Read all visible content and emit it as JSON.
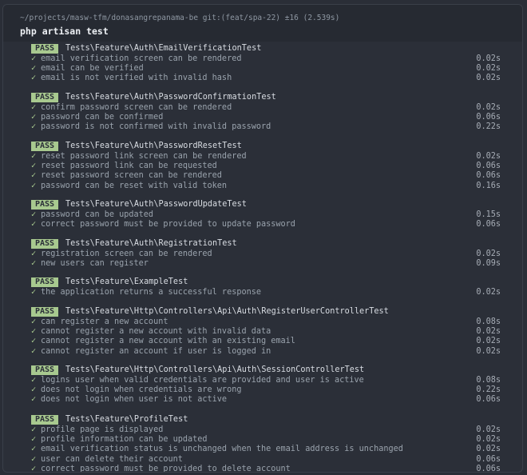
{
  "terminal": {
    "prompt": "~/projects/masw-tfm/donasangrepanama-be git:(feat/spa-22) ±16 (2.539s)",
    "command": "php artisan test",
    "check_glyph": "✓",
    "colors": {
      "background": "#2b2f38",
      "pass_badge": "#a8c98f",
      "check": "#a8c98f"
    }
  },
  "suites": [
    {
      "status": "PASS",
      "name": "Tests\\Feature\\Auth\\EmailVerificationTest",
      "tests": [
        {
          "name": "email verification screen can be rendered",
          "time": "0.02s"
        },
        {
          "name": "email can be verified",
          "time": "0.02s"
        },
        {
          "name": "email is not verified with invalid hash",
          "time": "0.02s"
        }
      ]
    },
    {
      "status": "PASS",
      "name": "Tests\\Feature\\Auth\\PasswordConfirmationTest",
      "tests": [
        {
          "name": "confirm password screen can be rendered",
          "time": "0.02s"
        },
        {
          "name": "password can be confirmed",
          "time": "0.06s"
        },
        {
          "name": "password is not confirmed with invalid password",
          "time": "0.22s"
        }
      ]
    },
    {
      "status": "PASS",
      "name": "Tests\\Feature\\Auth\\PasswordResetTest",
      "tests": [
        {
          "name": "reset password link screen can be rendered",
          "time": "0.02s"
        },
        {
          "name": "reset password link can be requested",
          "time": "0.06s"
        },
        {
          "name": "reset password screen can be rendered",
          "time": "0.06s"
        },
        {
          "name": "password can be reset with valid token",
          "time": "0.16s"
        }
      ]
    },
    {
      "status": "PASS",
      "name": "Tests\\Feature\\Auth\\PasswordUpdateTest",
      "tests": [
        {
          "name": "password can be updated",
          "time": "0.15s"
        },
        {
          "name": "correct password must be provided to update password",
          "time": "0.06s"
        }
      ]
    },
    {
      "status": "PASS",
      "name": "Tests\\Feature\\Auth\\RegistrationTest",
      "tests": [
        {
          "name": "registration screen can be rendered",
          "time": "0.02s"
        },
        {
          "name": "new users can register",
          "time": "0.09s"
        }
      ]
    },
    {
      "status": "PASS",
      "name": "Tests\\Feature\\ExampleTest",
      "tests": [
        {
          "name": "the application returns a successful response",
          "time": "0.02s"
        }
      ]
    },
    {
      "status": "PASS",
      "name": "Tests\\Feature\\Http\\Controllers\\Api\\Auth\\RegisterUserControllerTest",
      "tests": [
        {
          "name": "can register a new account",
          "time": "0.08s"
        },
        {
          "name": "cannot register a new account with invalid data",
          "time": "0.02s"
        },
        {
          "name": "cannot register a new account with an existing email",
          "time": "0.02s"
        },
        {
          "name": "cannot register an account if user is logged in",
          "time": "0.02s"
        }
      ]
    },
    {
      "status": "PASS",
      "name": "Tests\\Feature\\Http\\Controllers\\Api\\Auth\\SessionControllerTest",
      "tests": [
        {
          "name": "logins user when valid credentials are provided and user is active",
          "time": "0.08s"
        },
        {
          "name": "does not login when credentials are wrong",
          "time": "0.22s"
        },
        {
          "name": "does not login when user is not active",
          "time": "0.06s"
        }
      ]
    },
    {
      "status": "PASS",
      "name": "Tests\\Feature\\ProfileTest",
      "tests": [
        {
          "name": "profile page is displayed",
          "time": "0.02s"
        },
        {
          "name": "profile information can be updated",
          "time": "0.02s"
        },
        {
          "name": "email verification status is unchanged when the email address is unchanged",
          "time": "0.02s"
        },
        {
          "name": "user can delete their account",
          "time": "0.06s"
        },
        {
          "name": "correct password must be provided to delete account",
          "time": "0.06s"
        }
      ]
    }
  ]
}
